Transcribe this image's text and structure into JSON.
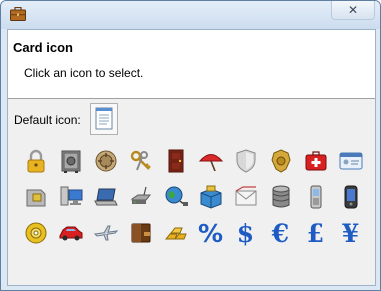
{
  "window": {
    "close_glyph": "✕"
  },
  "header": {
    "title": "Card icon",
    "subtitle": "Click an icon to select."
  },
  "default_icon": {
    "label": "Default icon:",
    "icon": "notepad-icon"
  },
  "icons": {
    "row1": [
      "padlock-icon",
      "safe-icon",
      "vault-dial-icon",
      "keys-icon",
      "door-icon",
      "umbrella-icon",
      "shield-icon",
      "police-badge-icon",
      "first-aid-kit-icon",
      "id-card-icon"
    ],
    "row2": [
      "sim-card-icon",
      "network-computer-icon",
      "laptop-icon",
      "router-icon",
      "globe-network-icon",
      "package-icon",
      "mail-icon",
      "database-icon",
      "mobile-phone-icon",
      "pda-icon"
    ],
    "row3": [
      "cd-disc-icon",
      "car-icon",
      "airplane-icon",
      "wallet-icon",
      "gold-bars-icon",
      "percent-icon",
      "dollar-icon",
      "euro-icon",
      "pound-icon",
      "yen-icon"
    ]
  },
  "symbols": {
    "percent": "%",
    "dollar": "$",
    "euro": "€",
    "pound": "£",
    "yen": "¥"
  }
}
